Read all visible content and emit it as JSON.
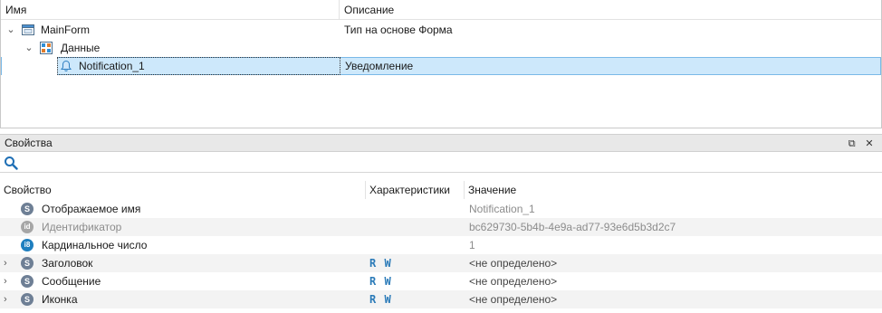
{
  "tree": {
    "columns": {
      "name": "Имя",
      "description": "Описание"
    },
    "rows": [
      {
        "label": "MainForm",
        "description": "Тип на основе Форма"
      },
      {
        "label": "Данные",
        "description": ""
      },
      {
        "label": "Notification_1",
        "description": "Уведомление"
      }
    ]
  },
  "properties": {
    "title": "Свойства",
    "search": {
      "value": "",
      "placeholder": ""
    },
    "columns": {
      "property": "Свойство",
      "characteristics": "Характеристики",
      "value": "Значение"
    },
    "rows": [
      {
        "badge": "S",
        "name": "Отображаемое имя",
        "characteristics": "",
        "value": "Notification_1",
        "expandable": false
      },
      {
        "badge": "id",
        "name": "Идентификатор",
        "characteristics": "",
        "value": "bc629730-5b4b-4e9a-ad77-93e6d5b3d2c7",
        "expandable": false
      },
      {
        "badge": "i8",
        "name": "Кардинальное число",
        "characteristics": "",
        "value": "1",
        "expandable": false
      },
      {
        "badge": "S",
        "name": "Заголовок",
        "characteristics": "R W",
        "value": "<не определено>",
        "expandable": true
      },
      {
        "badge": "S",
        "name": "Сообщение",
        "characteristics": "R W",
        "value": "<не определено>",
        "expandable": true
      },
      {
        "badge": "S",
        "name": "Иконка",
        "characteristics": "R W",
        "value": "<не определено>",
        "expandable": true
      }
    ]
  },
  "colors": {
    "selection": "#cde8fb",
    "selection_border": "#7ab9e8",
    "accent": "#2a7ab8"
  },
  "icons": {
    "form": "form-window-icon",
    "data": "data-folder-icon",
    "notification": "bell-icon",
    "search": "search-icon",
    "restore": "restore-window-icon",
    "close": "close-icon"
  }
}
